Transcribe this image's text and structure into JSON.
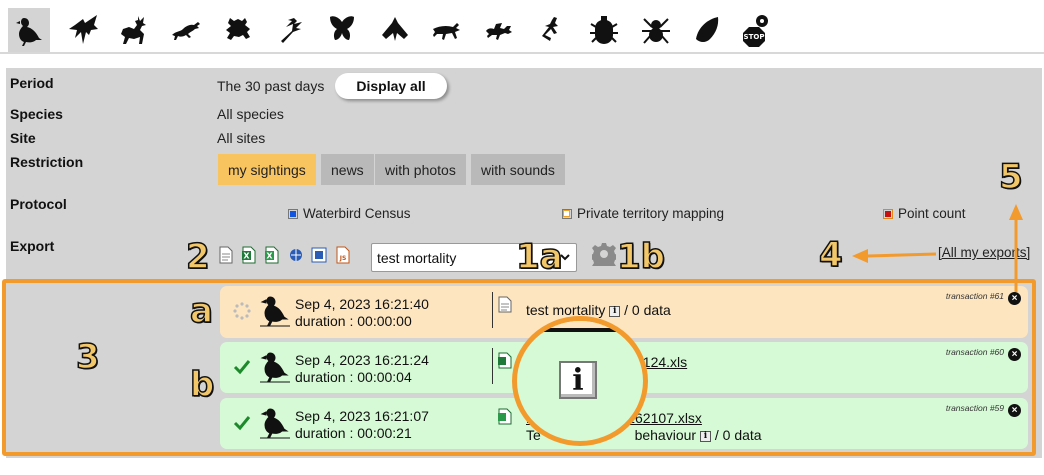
{
  "taxa": [
    {
      "name": "birds-icon",
      "active": true
    },
    {
      "name": "bats-icon"
    },
    {
      "name": "mammals-icon"
    },
    {
      "name": "reptiles-icon"
    },
    {
      "name": "amphibians-icon"
    },
    {
      "name": "dragonflies-icon"
    },
    {
      "name": "butterflies-icon"
    },
    {
      "name": "moths-icon"
    },
    {
      "name": "grasshoppers-icon"
    },
    {
      "name": "hymenoptera-icon"
    },
    {
      "name": "mantis-icon"
    },
    {
      "name": "beetles-icon"
    },
    {
      "name": "spiders-icon"
    },
    {
      "name": "molluscs-icon"
    },
    {
      "name": "stop-flower-icon"
    }
  ],
  "filters": {
    "period_label": "Period",
    "period_value": "The 30 past days",
    "display_all": "Display all",
    "species_label": "Species",
    "species_value": "All species",
    "site_label": "Site",
    "site_value": "All sites",
    "restriction_label": "Restriction",
    "restriction_tabs": [
      "my sightings",
      "news",
      "with photos",
      "with sounds"
    ],
    "protocol_label": "Protocol",
    "protocols": [
      {
        "label": "Waterbird Census",
        "color": "#1255e0"
      },
      {
        "label": "Private territory mapping",
        "color": "#f3a023"
      },
      {
        "label": "Point count",
        "color": "#c81010"
      }
    ],
    "export_label": "Export",
    "export_select_value": "test mortality",
    "all_exports": "[All my exports]"
  },
  "annotations": {
    "n2": "2",
    "n1a": "1a",
    "n1b": "1b",
    "n4": "4",
    "n5": "5",
    "n3": "3",
    "na": "a",
    "nb": "b"
  },
  "transactions": [
    {
      "state": "pending",
      "date": "Sep 4, 2023 16:21:40",
      "duration": "duration : 00:00:00",
      "file": "test mortality",
      "sub": "/ 0 data",
      "txid": "transaction #61"
    },
    {
      "state": "done",
      "date": "Sep 4, 2023 16:21:24",
      "duration": "duration : 00:00:04",
      "file_prefix": "C",
      "file": "05_04092023_162124.xls",
      "sub": "",
      "txid": "transaction #60"
    },
    {
      "state": "done",
      "date": "Sep 4, 2023 16:21:07",
      "duration": "duration : 00:00:21",
      "file": "199_04092023_162107.xlsx",
      "sub_prefix": "Te",
      "sub_mid": "behaviour",
      "sub": "/ 0 data",
      "txid": "transaction #59"
    }
  ],
  "zoom": {
    "glyph": "i"
  },
  "colors": {
    "panel": "#d4d4d4",
    "active_tab": "#f8c45f",
    "pending_card": "#fde5c0",
    "done_card": "#d6fad6",
    "annotation_orange": "#f39a2d",
    "check_green": "#1c8a2a"
  }
}
